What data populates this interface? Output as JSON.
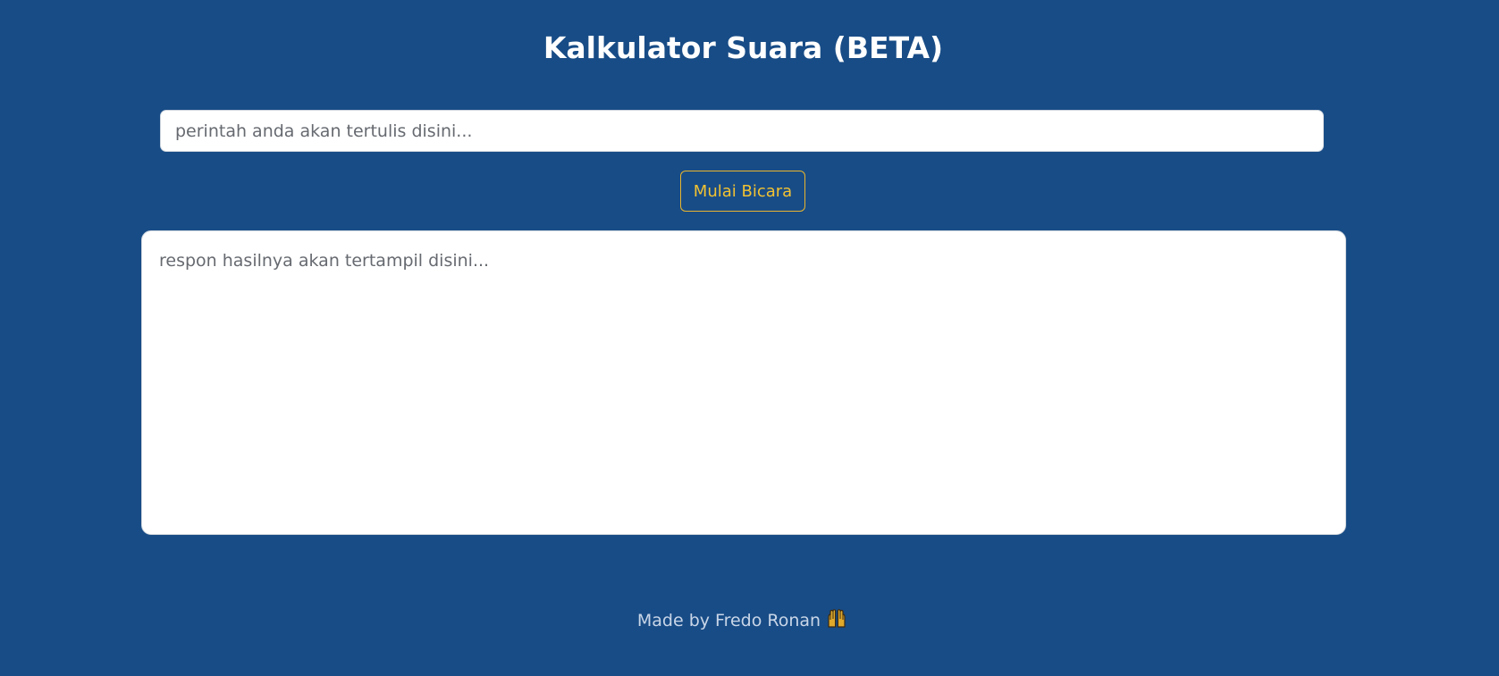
{
  "header": {
    "title": "Kalkulator Suara (BETA)"
  },
  "command": {
    "placeholder": "perintah anda akan tertulis disini...",
    "value": ""
  },
  "speak_button": {
    "label": "Mulai Bicara",
    "color": "#f2c232"
  },
  "response": {
    "placeholder": "respon hasilnya akan tertampil disini...",
    "value": ""
  },
  "footer": {
    "text": "Made by Fredo Ronan",
    "icon": "raised-hands-icon"
  },
  "colors": {
    "background": "#184c86",
    "accent": "#f2c232"
  }
}
